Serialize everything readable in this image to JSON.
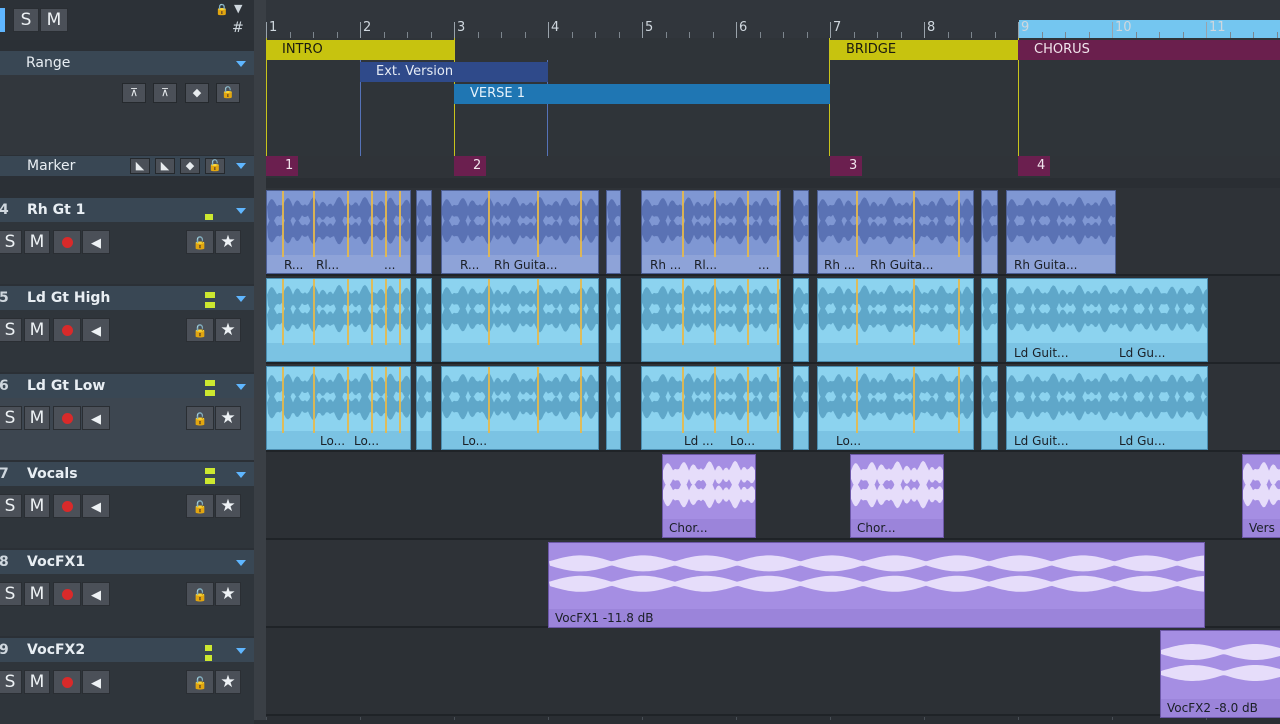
{
  "top_controls": {
    "s": "S",
    "m": "M",
    "hash": "#"
  },
  "range": {
    "label": "Range"
  },
  "marker": {
    "label": "Marker"
  },
  "ruler": {
    "bars": [
      "1",
      "2",
      "3",
      "4",
      "5",
      "6",
      "7",
      "8",
      "9",
      "10",
      "11"
    ]
  },
  "arranger_sections": [
    {
      "label": "INTRO"
    },
    {
      "label": "Ext. Version"
    },
    {
      "label": "VERSE 1"
    },
    {
      "label": "BRIDGE"
    },
    {
      "label": "CHORUS"
    }
  ],
  "markers": [
    "1",
    "2",
    "3",
    "4"
  ],
  "tracks": [
    {
      "num": "4",
      "name": "Rh Gt 1",
      "s": "S",
      "m": "M"
    },
    {
      "num": "5",
      "name": "Ld Gt High",
      "s": "S",
      "m": "M"
    },
    {
      "num": "6",
      "name": "Ld Gt Low",
      "s": "S",
      "m": "M"
    },
    {
      "num": "7",
      "name": "Vocals",
      "s": "S",
      "m": "M"
    },
    {
      "num": "8",
      "name": "VocFX1",
      "s": "S",
      "m": "M"
    },
    {
      "num": "9",
      "name": "VocFX2",
      "s": "S",
      "m": "M"
    }
  ],
  "clips": {
    "rh1": [
      "R...",
      "Rl...",
      "...",
      "R...",
      "Rh Guita...",
      "Rh ...",
      "Rl...",
      "...",
      "Rh ...",
      "Rh Guita...",
      "Rh Guita..."
    ],
    "ldhigh": [
      "Ld Guit...",
      "Ld Gu..."
    ],
    "ldlow": [
      "Lo...",
      "Lo...",
      "Lo...",
      "Ld ...",
      "Lo...",
      "Lo...",
      "Ld Guit...",
      "Ld Gu..."
    ],
    "vocals": [
      "Chor...",
      "Chor...",
      "Vers"
    ],
    "vocfx1": "VocFX1   -11.8 dB",
    "vocfx2": "VocFX2   -8.0 dB"
  },
  "icons": [
    "lock-icon",
    "star-icon",
    "speaker-icon",
    "record-icon"
  ]
}
